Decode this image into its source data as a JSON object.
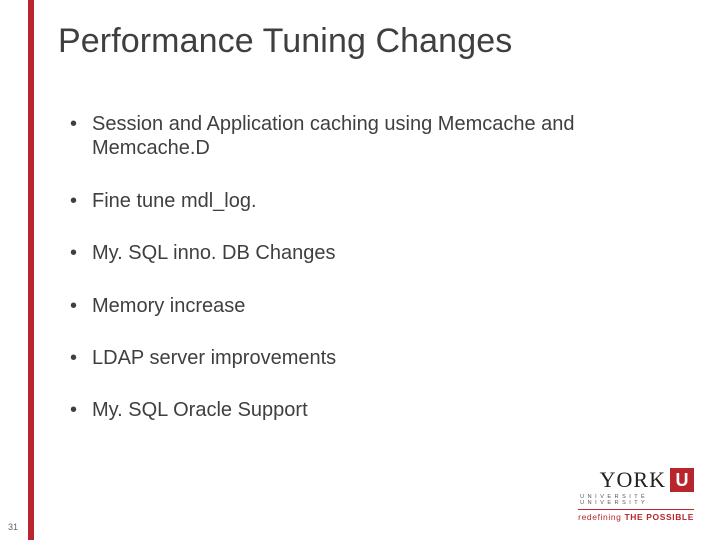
{
  "slide": {
    "title": "Performance Tuning Changes",
    "bullets": [
      "Session and Application caching using Memcache and Memcache.D",
      "Fine tune mdl_log.",
      "My. SQL inno. DB Changes",
      "Memory increase",
      "LDAP server improvements",
      "My. SQL Oracle Support"
    ],
    "page_number": "31"
  },
  "logo": {
    "name": "YORK",
    "u": "U",
    "subline": "U N I V E R S I T É\nU N I V E R S I T Y",
    "tagline_prefix": "redefining ",
    "tagline_bold": "THE POSSIBLE"
  },
  "colors": {
    "accent": "#b8252c"
  }
}
